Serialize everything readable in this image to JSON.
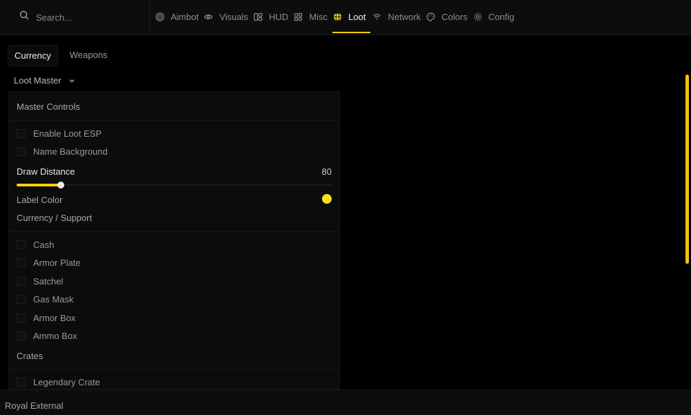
{
  "search": {
    "placeholder": "Search..."
  },
  "nav": {
    "tabs": [
      {
        "label": "Aimbot",
        "icon": "target-icon"
      },
      {
        "label": "Visuals",
        "icon": "eye-icon"
      },
      {
        "label": "HUD",
        "icon": "hud-icon"
      },
      {
        "label": "Misc",
        "icon": "grid-icon"
      },
      {
        "label": "Loot",
        "icon": "globe-icon",
        "active": true
      },
      {
        "label": "Network",
        "icon": "wifi-icon"
      },
      {
        "label": "Colors",
        "icon": "palette-icon"
      },
      {
        "label": "Config",
        "icon": "gear-icon"
      }
    ],
    "accent": "#f5d20c"
  },
  "subtabs": {
    "currency": "Currency",
    "weapons": "Weapons"
  },
  "dropdown": {
    "value": "Loot Master"
  },
  "master": {
    "title": "Master Controls",
    "enable_loot_esp": "Enable Loot ESP",
    "name_background": "Name Background",
    "draw_distance_label": "Draw Distance",
    "draw_distance_value": "80",
    "draw_distance_fraction": 0.14,
    "label_color_label": "Label Color",
    "label_color": "#f5e01a"
  },
  "currency_support": {
    "title": "Currency / Support",
    "items": [
      "Cash",
      "Armor Plate",
      "Satchel",
      "Gas Mask",
      "Armor Box",
      "Ammo Box"
    ]
  },
  "crates": {
    "title": "Crates",
    "items": [
      "Legendary Crate"
    ]
  },
  "footer": {
    "label": "Royal External"
  }
}
